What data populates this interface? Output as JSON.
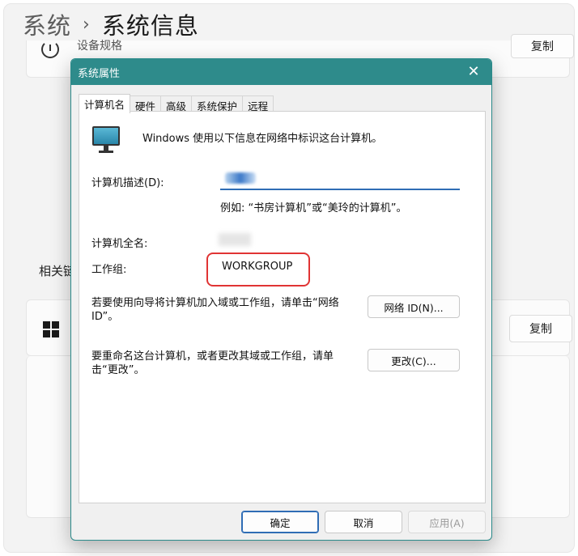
{
  "breadcrumb": {
    "parent": "系统",
    "separator": "›",
    "current": "系统信息"
  },
  "background": {
    "card1_text": "设备规格",
    "copy_label_1": "复制",
    "related_text": "相关链",
    "copy_label_2": "复制"
  },
  "dialog": {
    "title": "系统属性",
    "close": "✕",
    "tabs": [
      {
        "label": "计算机名",
        "active": true
      },
      {
        "label": "硬件",
        "active": false
      },
      {
        "label": "高级",
        "active": false
      },
      {
        "label": "系统保护",
        "active": false
      },
      {
        "label": "远程",
        "active": false
      }
    ],
    "intro": "Windows 使用以下信息在网络中标识这台计算机。",
    "description_label": "计算机描述(D):",
    "description_value": "",
    "example": "例如: “书房计算机”或“美玲的计算机”。",
    "fullname_label": "计算机全名:",
    "workgroup_label": "工作组:",
    "workgroup_value": "WORKGROUP",
    "network_hint": "若要使用向导将计算机加入域或工作组，请单击“网络 ID”。",
    "network_id_button": "网络 ID(N)...",
    "rename_hint": "要重命名这台计算机，或者更改其域或工作组，请单击“更改”。",
    "change_button": "更改(C)...",
    "ok_button": "确定",
    "cancel_button": "取消",
    "apply_button": "应用(A)",
    "title_color": "#2e8b8b",
    "highlight_color": "#e03434"
  }
}
